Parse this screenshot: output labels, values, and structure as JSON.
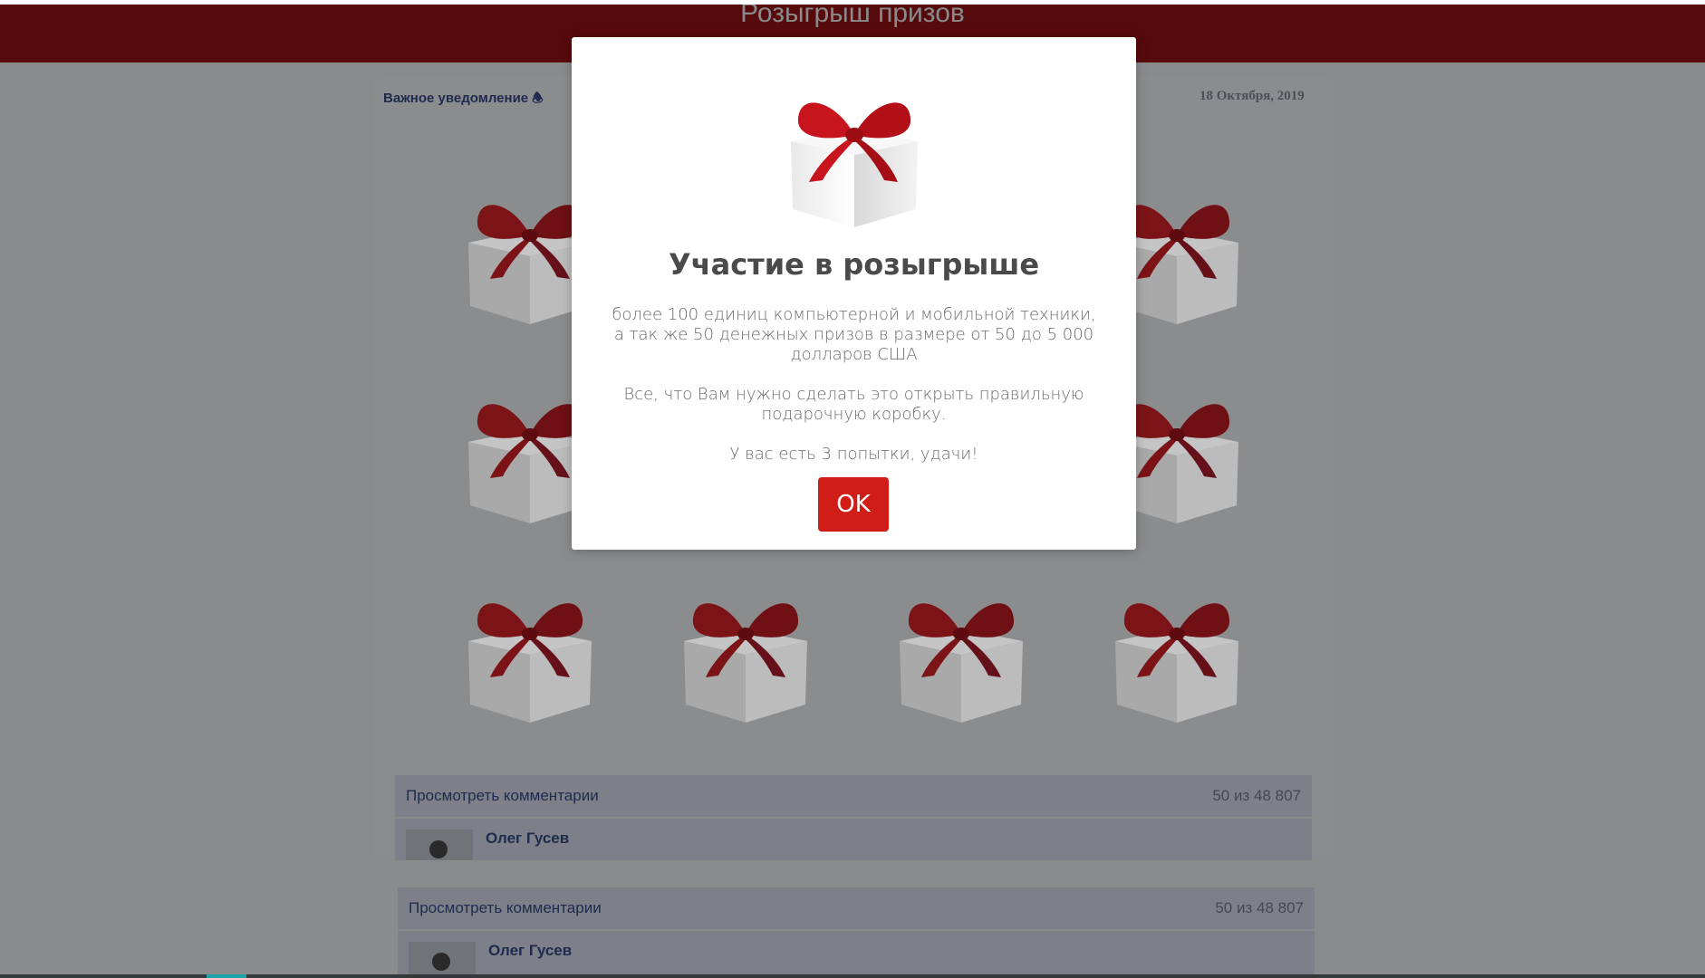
{
  "header": {
    "title": "Розыгрыш призов"
  },
  "post": {
    "notice_label": "Важное уведомление",
    "date": "18 Октября, 2019"
  },
  "gifts_count": 12,
  "comments_blocks": [
    {
      "view_label": "Просмотреть комментарии",
      "count": "50 из 48 807",
      "author": "Олег Гусев"
    },
    {
      "view_label": "Просмотреть комментарии",
      "count": "50 из 48 807",
      "author": "Олег Гусев"
    }
  ],
  "modal": {
    "title": "Участие в розыгрыше",
    "line1": "более 100 единиц компьютерной и мобильной техники,",
    "line2": "а так же 50 денежных призов в размере от 50 до 5 000 долларов США",
    "line3": "Все, что Вам нужно сделать это открыть правильную подарочную коробку.",
    "line4": "У вас есть 3 попытки, удачи!",
    "ok_label": "OK"
  },
  "colors": {
    "header_bg": "#570a0c",
    "ok_button": "#d01d17",
    "ribbon": "#c8141c"
  },
  "icons": {
    "notice": "bell-icon",
    "gift": "gift-box-icon",
    "avatar": "user-avatar-icon"
  }
}
